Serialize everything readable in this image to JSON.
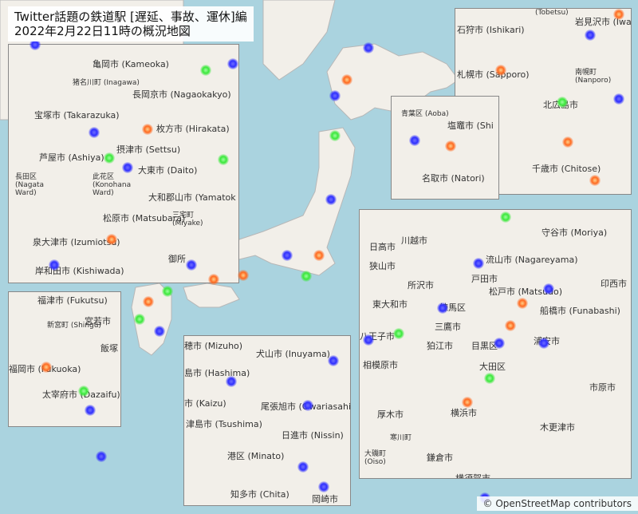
{
  "title": "Twitter話題の鉄道駅 [遅延、事故、運休]編\n2022年2月22日11時の概況地図",
  "attribution": "© OpenStreetMap contributors",
  "colors": {
    "sea": "#aad3df",
    "land": "#f2efe9",
    "green_area": "#cde6b5",
    "blue": "#3030ff",
    "green": "#3be83b",
    "orange": "#ff6a20"
  },
  "insets": {
    "kansai": {
      "labels": [
        "亀岡市 (Kameoka)",
        "猪名川町 (Inagawa)",
        "長岡京市 (Nagaokakyo)",
        "宝塚市 (Takarazuka)",
        "枚方市 (Hirakata)",
        "摂津市 (Settsu)",
        "芦屋市 (Ashiya)",
        "大東市 (Daito)",
        "長田区 (Nagata Ward)",
        "此花区 (Konohana Ward)",
        "大和郡山市 (Yamatok",
        "松原市 (Matsubara)",
        "三宅町 (Miyake)",
        "泉大津市 (Izumiotsu)",
        "岸和田市 (Kishiwada)",
        "御所"
      ]
    },
    "sapporo": {
      "labels": [
        "(Tobetsu)",
        "岩見沢市 (Iwa",
        "石狩市 (Ishikari)",
        "札幌市 (Sapporo)",
        "南幌町 (Nanporo)",
        "北広島市",
        "千歳市 (Chitose)"
      ]
    },
    "sendai": {
      "labels": [
        "青葉区 (Aoba)",
        "塩竈市 (Shi",
        "名取市 (Natori)"
      ]
    },
    "fukuoka": {
      "labels": [
        "福津市 (Fukutsu)",
        "新宮町 (Shingu)",
        "宮若市",
        "飯塚",
        "福岡市 (Fukuoka)",
        "太宰府市 (Dazaifu)"
      ]
    },
    "nagoya": {
      "labels": [
        "穂市 (Mizuho)",
        "犬山市 (Inuyama)",
        "島市 (Hashima)",
        "市 (Kaizu)",
        "尾張旭市 (Owariasahi)",
        "津島市 (Tsushima)",
        "日進市 (Nissin)",
        "港区 (Minato)",
        "知多市 (Chita)",
        "岡崎市"
      ]
    },
    "tokyo": {
      "labels": [
        "守谷市 (Moriya)",
        "日高市",
        "川越市",
        "狭山市",
        "流山市 (Nagareyama)",
        "所沢市",
        "戸田市",
        "東大和市",
        "松戸市 (Matsudo)",
        "印西市",
        "練馬区",
        "船橋市 (Funabashi)",
        "八王子市",
        "三鷹市",
        "狛江市",
        "目黒区",
        "浦安市",
        "相模原市",
        "大田区",
        "市原市",
        "厚木市",
        "横浜市",
        "寒川町",
        "大磯町 (Oiso)",
        "鎌倉市",
        "木更津市",
        "横須賀市"
      ]
    }
  }
}
